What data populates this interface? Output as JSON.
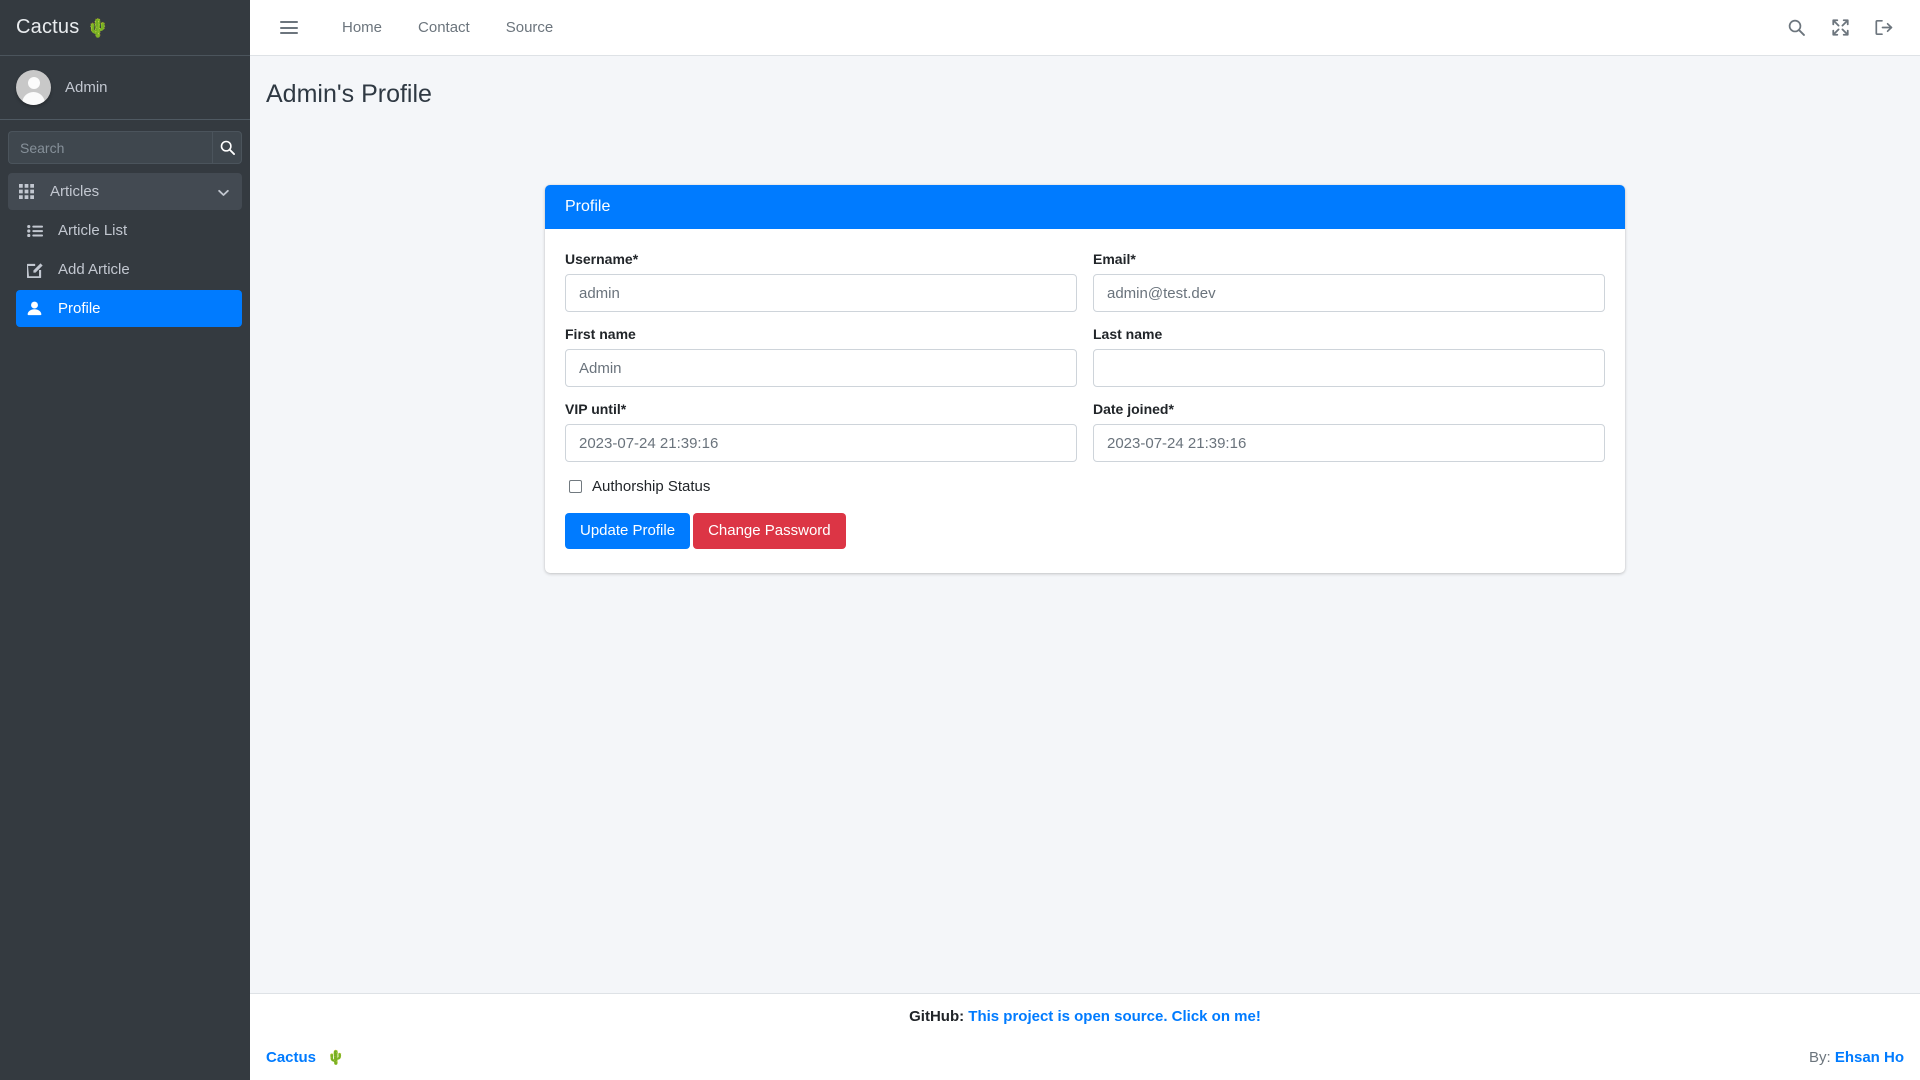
{
  "brand": {
    "name": "Cactus",
    "emoji": "🌵"
  },
  "sidebar": {
    "user": {
      "name": "Admin",
      "avatar_icon": "user-avatar-icon"
    },
    "search": {
      "placeholder": "Search",
      "value": "",
      "button_icon": "search-icon"
    },
    "items": [
      {
        "label": "Articles",
        "icon": "grid-icon",
        "state": "open",
        "chevron": "chevron-down-icon"
      },
      {
        "label": "Article List",
        "icon": "list-icon",
        "state": "normal"
      },
      {
        "label": "Add Article",
        "icon": "edit-square-icon",
        "state": "normal"
      },
      {
        "label": "Profile",
        "icon": "user-icon",
        "state": "active"
      }
    ]
  },
  "navbar": {
    "toggle_icon": "hamburger-icon",
    "links": [
      {
        "label": "Home"
      },
      {
        "label": "Contact"
      },
      {
        "label": "Source"
      }
    ],
    "right_icons": [
      {
        "name": "search-icon"
      },
      {
        "name": "fullscreen-expand-icon"
      },
      {
        "name": "logout-icon"
      }
    ]
  },
  "page": {
    "title": "Admin's Profile"
  },
  "card": {
    "header": "Profile",
    "fields": [
      {
        "label": "Username*",
        "value": "admin",
        "placeholder": "admin",
        "name": "username"
      },
      {
        "label": "Email*",
        "value": "admin@test.dev",
        "placeholder": "admin@test.dev",
        "name": "email"
      },
      {
        "label": "First name",
        "value": "Admin",
        "placeholder": "Admin",
        "name": "first-name"
      },
      {
        "label": "Last name",
        "value": "",
        "placeholder": "",
        "name": "last-name"
      },
      {
        "label": "VIP until*",
        "value": "2023-07-24 21:39:16",
        "placeholder": "2023-07-24 21:39:16",
        "name": "vip-until"
      },
      {
        "label": "Date joined*",
        "value": "2023-07-24 21:39:16",
        "placeholder": "2023-07-24 21:39:16",
        "name": "date-joined"
      }
    ],
    "checkbox": {
      "label": "Authorship Status",
      "checked": false
    },
    "buttons": [
      {
        "label": "Update Profile",
        "style": "primary",
        "color": "#007bff"
      },
      {
        "label": "Change Password",
        "style": "danger",
        "color": "#dc3545"
      }
    ]
  },
  "footer": {
    "github_prefix": "GitHub:",
    "github_link": "This project is open source. Click on me!",
    "brand": "Cactus",
    "brand_emoji": "🌵",
    "by_prefix": "By:",
    "author": "Ehsan Ho"
  },
  "colors": {
    "sidebar_bg": "#343a40",
    "accent": "#007bff",
    "danger": "#dc3545",
    "content_bg": "#f4f6f9"
  }
}
